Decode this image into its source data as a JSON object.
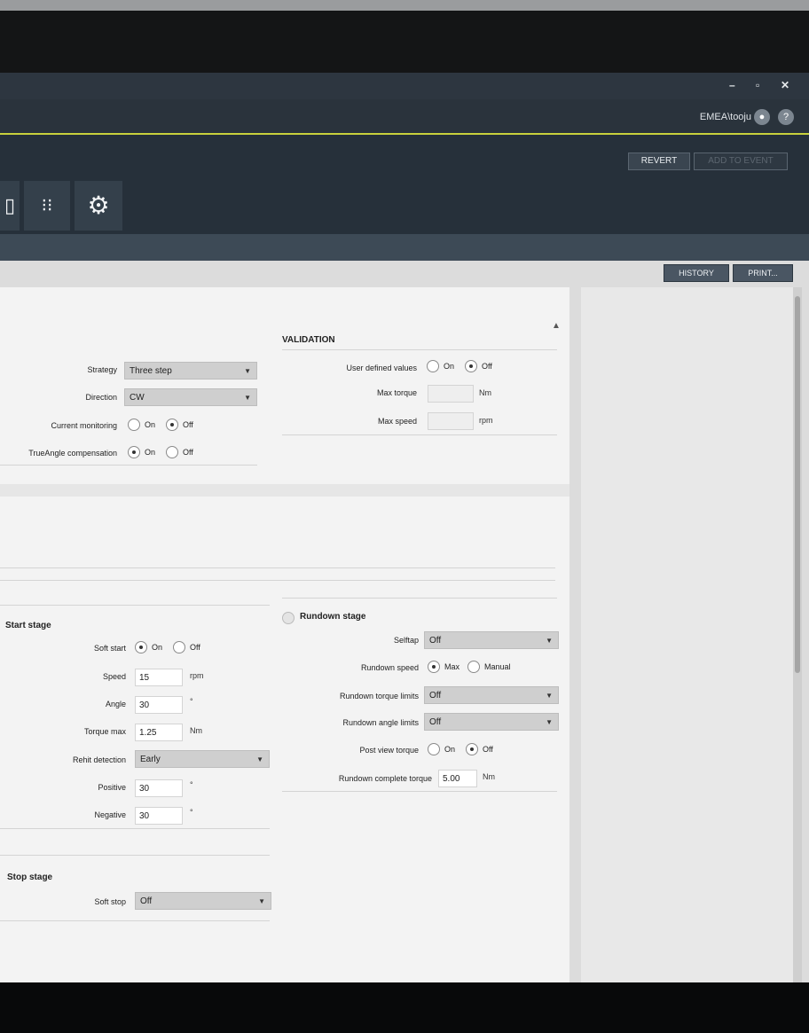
{
  "window": {
    "controls": [
      "–",
      "▫",
      "✕"
    ]
  },
  "user": {
    "name": "EMEA\\tooju",
    "user_icon": "person-icon",
    "help_icon": "?"
  },
  "toolbar": {
    "revert_label": "REVERT",
    "add_label": "ADD TO EVENT",
    "icons": [
      "tablet-icon",
      "tool-list-icon",
      "gear-icon"
    ],
    "icon_glyphs": [
      "▯",
      "⁝⁝",
      "⚙"
    ]
  },
  "actions": {
    "history_label": "HISTORY",
    "print_label": "PRINT..."
  },
  "strategy": {
    "strategy_label": "Strategy",
    "strategy_value": "Three step",
    "direction_label": "Direction",
    "direction_value": "CW",
    "current_monitoring_label": "Current monitoring",
    "trueangle_label": "TrueAngle compensation",
    "on": "On",
    "off": "Off"
  },
  "validation": {
    "title": "VALIDATION",
    "user_defined_label": "User defined values",
    "max_torque_label": "Max torque",
    "max_torque_unit": "Nm",
    "max_speed_label": "Max speed",
    "max_speed_unit": "rpm",
    "on": "On",
    "off": "Off"
  },
  "start_stage": {
    "title": "Start stage",
    "soft_start_label": "Soft start",
    "speed_label": "Speed",
    "speed_value": "15",
    "speed_unit": "rpm",
    "angle_label": "Angle",
    "angle_value": "30",
    "angle_unit": "°",
    "torque_max_label": "Torque max",
    "torque_max_value": "1.25",
    "torque_max_unit": "Nm",
    "rehit_label": "Rehit detection",
    "rehit_value": "Early",
    "positive_label": "Positive",
    "positive_value": "30",
    "positive_unit": "°",
    "negative_label": "Negative",
    "negative_value": "30",
    "negative_unit": "°",
    "on": "On",
    "off": "Off"
  },
  "rundown_stage": {
    "title": "Rundown stage",
    "selftap_label": "Selftap",
    "selftap_value": "Off",
    "speed_label": "Rundown speed",
    "max_label": "Max",
    "manual_label": "Manual",
    "torque_limits_label": "Rundown torque limits",
    "torque_limits_value": "Off",
    "angle_limits_label": "Rundown angle limits",
    "angle_limits_value": "Off",
    "post_view_label": "Post view torque",
    "complete_torque_label": "Rundown complete torque",
    "complete_torque_value": "5.00",
    "complete_torque_unit": "Nm",
    "on": "On",
    "off": "Off"
  },
  "stop_stage": {
    "title": "Stop stage",
    "soft_stop_label": "Soft stop",
    "soft_stop_value": "Off"
  }
}
